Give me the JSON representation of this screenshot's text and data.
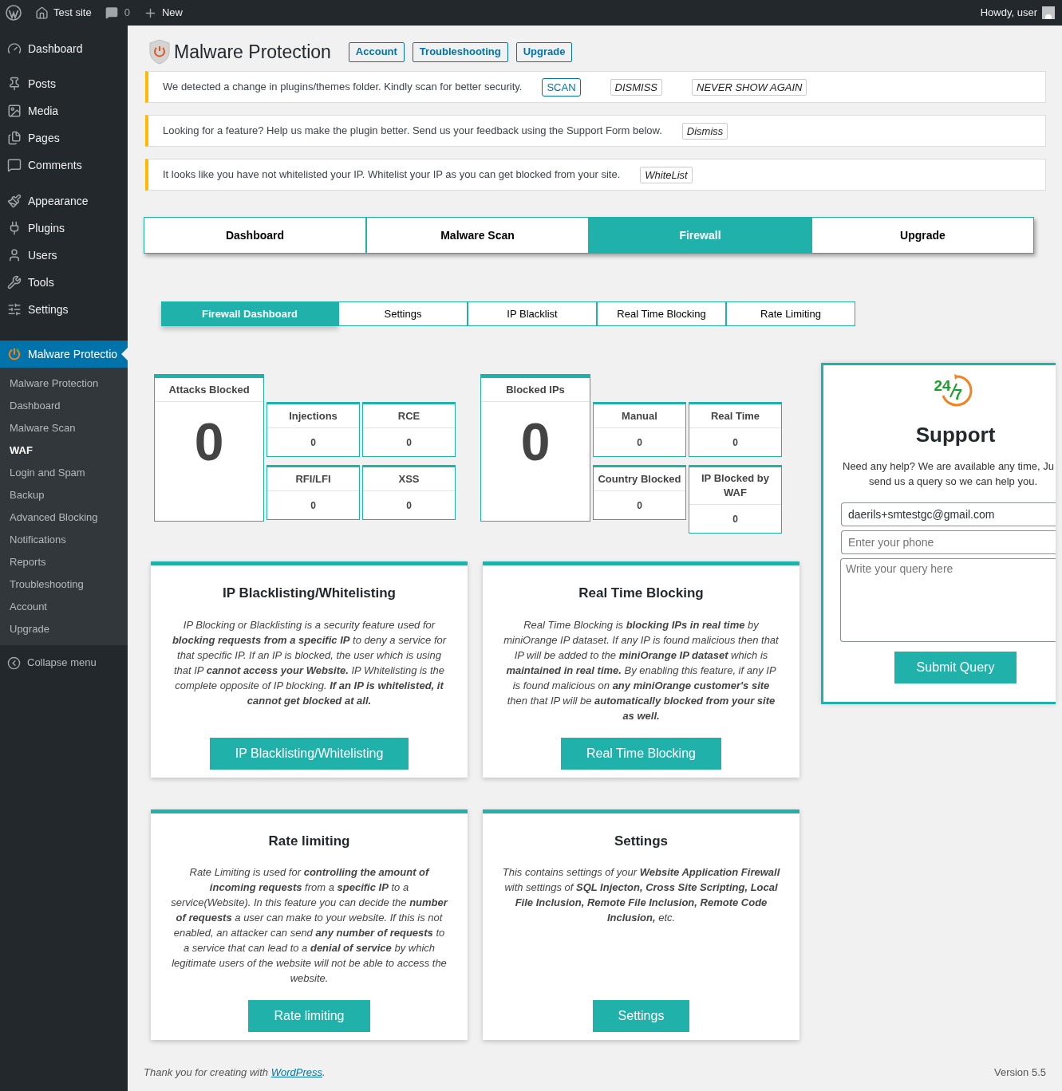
{
  "admin_bar": {
    "site": "Test site",
    "comments": "0",
    "new": "New",
    "greeting": "Howdy, user"
  },
  "sidebar": {
    "groups": [
      [
        {
          "label": "Dashboard",
          "selected": false
        }
      ],
      [
        {
          "label": "Posts",
          "selected": false
        },
        {
          "label": "Media",
          "selected": false
        },
        {
          "label": "Pages",
          "selected": false
        },
        {
          "label": "Comments",
          "selected": false
        }
      ],
      [
        {
          "label": "Appearance",
          "selected": false
        },
        {
          "label": "Plugins",
          "selected": false
        },
        {
          "label": "Users",
          "selected": false
        },
        {
          "label": "Tools",
          "selected": false
        },
        {
          "label": "Settings",
          "selected": false
        }
      ],
      [
        {
          "label": "Malware Protectio",
          "selected": true
        }
      ]
    ],
    "submenu": [
      {
        "label": "Malware Protection",
        "selected": false
      },
      {
        "label": "Dashboard",
        "selected": false
      },
      {
        "label": "Malware Scan",
        "selected": false
      },
      {
        "label": "WAF",
        "selected": true
      },
      {
        "label": "Login and Spam",
        "selected": false
      },
      {
        "label": "Backup",
        "selected": false
      },
      {
        "label": "Advanced Blocking",
        "selected": false
      },
      {
        "label": "Notifications",
        "selected": false
      },
      {
        "label": "Reports",
        "selected": false
      },
      {
        "label": "Troubleshooting",
        "selected": false
      },
      {
        "label": "Account",
        "selected": false
      },
      {
        "label": "Upgrade",
        "selected": false
      }
    ],
    "collapse": "Collapse menu"
  },
  "header": {
    "title": "Malware Protection",
    "buttons": [
      "Account",
      "Troubleshooting",
      "Upgrade"
    ]
  },
  "notices": [
    {
      "text": "We detected a change in plugins/themes folder. Kindly scan for better security.",
      "buttons": [
        {
          "label": "SCAN",
          "kind": "primary"
        },
        {
          "label": "DISMISS",
          "kind": "secondary"
        },
        {
          "label": "NEVER SHOW AGAIN",
          "kind": "secondary"
        }
      ]
    },
    {
      "text": "Looking for a feature? Help us make the plugin better. Send us your feedback using the Support Form below.",
      "buttons": [
        {
          "label": "Dismiss",
          "kind": "secondary"
        }
      ]
    },
    {
      "text": "It looks like you have not whitelisted your IP. Whitelist your IP as you can get blocked from your site.",
      "buttons": [
        {
          "label": "WhiteList",
          "kind": "secondary"
        }
      ]
    }
  ],
  "tabs": [
    {
      "label": "Dashboard",
      "selected": false
    },
    {
      "label": "Malware Scan",
      "selected": false
    },
    {
      "label": "Firewall",
      "selected": true
    },
    {
      "label": "Upgrade",
      "selected": false
    }
  ],
  "subtabs": [
    {
      "label": "Firewall Dashboard",
      "selected": true
    },
    {
      "label": "Settings",
      "selected": false
    },
    {
      "label": "IP Blacklist",
      "selected": false
    },
    {
      "label": "Real Time Blocking",
      "selected": false
    },
    {
      "label": "Rate Limiting",
      "selected": false
    }
  ],
  "stats": [
    {
      "title": "Attacks Blocked",
      "value": "0",
      "items": [
        {
          "label": "Injections",
          "value": "0"
        },
        {
          "label": "RCE",
          "value": "0"
        },
        {
          "label": "RFI/LFI",
          "value": "0"
        },
        {
          "label": "XSS",
          "value": "0"
        }
      ]
    },
    {
      "title": "Blocked IPs",
      "value": "0",
      "items": [
        {
          "label": "Manual",
          "value": "0"
        },
        {
          "label": "Real Time",
          "value": "0"
        },
        {
          "label": "Country Blocked",
          "value": "0"
        },
        {
          "label": "IP Blocked by WAF",
          "value": "0"
        }
      ]
    }
  ],
  "features": [
    {
      "title": "IP Blacklisting/Whitelisting",
      "text": "IP Blocking or Blacklisting is a security feature used for **blocking requests from a specific IP** to deny a service for that specific IP. If an IP is blocked, the user which is using that IP **cannot access your Website.** IP Whitelisting is the complete opposite of IP blocking. **If an IP is whitelisted, it cannot get blocked at all.**",
      "button": "IP Blacklisting/Whitelisting"
    },
    {
      "title": "Real Time Blocking",
      "text": "Real Time Blocking is **blocking IPs in real time** by miniOrange IP dataset. If any IP is found malicious then that IP will be added to the **miniOrange IP dataset** which is **maintained in real time.** By enabling this feature, if any IP is found malicious on **any miniOrange customer's site** then that IP will be **automatically blocked from your site as well.**",
      "button": "Real Time Blocking"
    },
    {
      "title": "Rate limiting",
      "text": "Rate Limiting is used for **controlling the amount of incoming requests** from a **specific IP** to a service(Website). In this feature you can decide the **number of requests** a user can make to your website. If this is not enabled, an attacker can send **any number of requests** to a service that can lead to a **denial of service** by which legitimate users of the website will not be able to access the website.",
      "button": "Rate limiting"
    },
    {
      "title": "Settings",
      "text": "This contains settings of your **Website Application Firewall** with settings of **SQL Injecton, Cross Site Scripting, Local File Inclusion, Remote File Inclusion, Remote Code Inclusion,** etc.",
      "button": "Settings"
    }
  ],
  "support": {
    "logo": [
      "24",
      "7"
    ],
    "title": "Support",
    "description": [
      "Need any help? We are available any time, Ju",
      "send us a query so we can help you."
    ],
    "email": "daerils+smtestgc@gmail.com",
    "phone_placeholder": "Enter your phone",
    "query_placeholder": "Write your query here",
    "button": "Submit Query"
  },
  "footer": {
    "text": "Thank you for creating with ",
    "link": "WordPress",
    "end": ".",
    "version": "Version 5.5"
  }
}
